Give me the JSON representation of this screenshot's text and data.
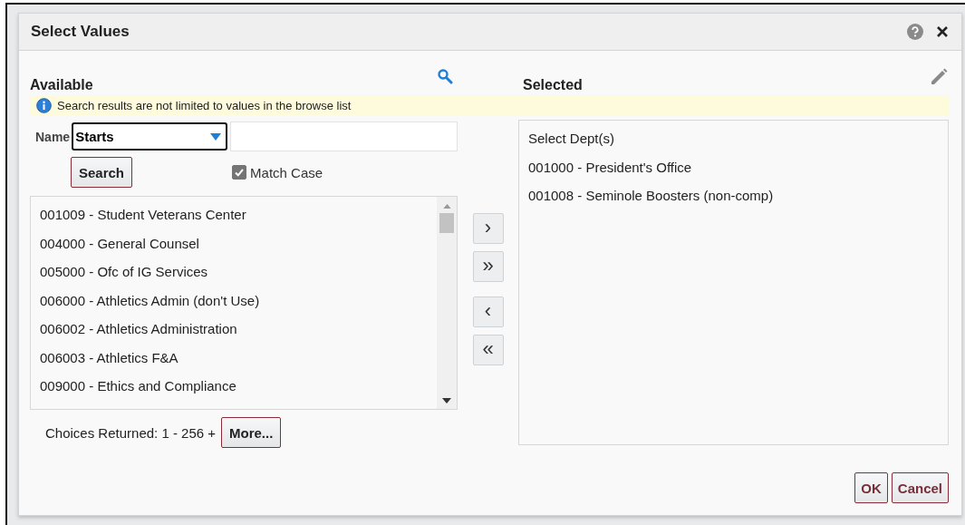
{
  "dialog": {
    "title": "Select Values"
  },
  "available": {
    "heading": "Available",
    "info": "Search results are not limited to values in the browse list",
    "name_label": "Name",
    "operator": "Starts",
    "search_button": "Search",
    "match_case": {
      "label": "Match Case",
      "checked": true
    },
    "items": [
      {
        "label": "001009 - Student Veterans Center",
        "selected": false
      },
      {
        "label": "004000 - General Counsel",
        "selected": false
      },
      {
        "label": "005000 - Ofc of IG Services",
        "selected": false
      },
      {
        "label": "006000 - Athletics Admin (don't Use)",
        "selected": false
      },
      {
        "label": "006002 - Athletics Administration",
        "selected": false
      },
      {
        "label": "006003 - Athletics F&A",
        "selected": false
      },
      {
        "label": "009000 - Ethics and Compliance",
        "selected": false
      }
    ],
    "choices_returned": "Choices Returned: 1 - 256 +",
    "more_button": "More..."
  },
  "move_buttons": [
    "›",
    "»",
    "‹",
    "«"
  ],
  "selected": {
    "heading": "Selected",
    "items": [
      "Select Dept(s)",
      "001000 - President's Office",
      "001008 - Seminole Boosters (non-comp)"
    ]
  },
  "buttons": [
    "OK",
    "Cancel"
  ]
}
